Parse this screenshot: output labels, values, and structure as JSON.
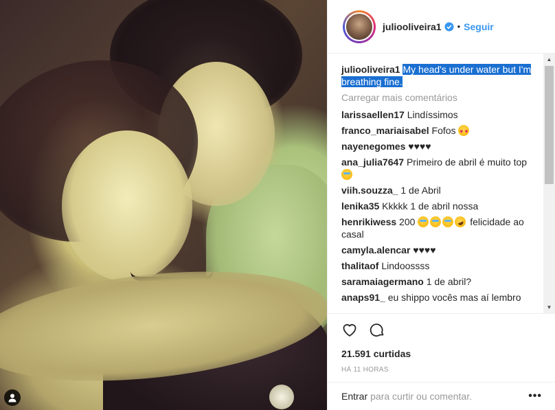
{
  "post": {
    "username": "juliooliveira1",
    "follow_label": "Seguir",
    "separator": "•",
    "caption_text": "My head's under water but I'm breathing fine.",
    "load_more": "Carregar mais comentários",
    "likes": "21.591 curtidas",
    "time_ago": "HÁ 11 HORAS",
    "comment_login": "Entrar",
    "comment_rest": "para curtir ou comentar.",
    "more_label": "•••"
  },
  "comments": [
    {
      "user": "larissaellen17",
      "text": "Lindíssimos"
    },
    {
      "user": "franco_mariaisabel",
      "text": "Fofos",
      "emoji": [
        "heart-eyes-icon"
      ]
    },
    {
      "user": "nayenegomes",
      "text": "♥♥♥♥"
    },
    {
      "user": "ana_julia7647",
      "text": "Primeiro de abril é muito top",
      "emoji": [
        "crying-laughing-icon"
      ]
    },
    {
      "user": "viih.souzza_",
      "text": "1 de Abril"
    },
    {
      "user": "lenika35",
      "text": "Kkkkk 1 de abril nossa"
    },
    {
      "user": "henrikiwess",
      "text": "200",
      "emoji": [
        "crying-laughing-icon",
        "crying-laughing-icon",
        "crying-laughing-icon",
        "rolling-laughing-icon"
      ],
      "text_after": "felicidade ao casal"
    },
    {
      "user": "camyla.alencar",
      "text": "♥♥♥♥"
    },
    {
      "user": "thalitaof",
      "text": "Lindoossss"
    },
    {
      "user": "saramaiagermano",
      "text": "1 de abril?"
    },
    {
      "user": "anaps91_",
      "text": "eu shippo vocês mas aí lembro"
    }
  ],
  "colors": {
    "link": "#3897f0",
    "highlight": "#1a6fd1",
    "muted": "#999999"
  }
}
